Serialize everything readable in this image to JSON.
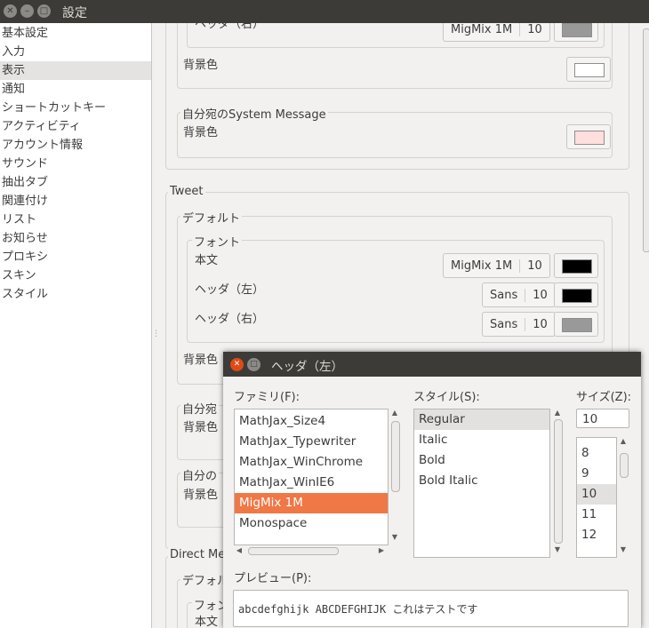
{
  "window": {
    "title": "設定"
  },
  "sidebar": {
    "items": [
      "基本設定",
      "入力",
      "表示",
      "通知",
      "ショートカットキー",
      "アクティビティ",
      "アカウント情報",
      "サウンド",
      "抽出タブ",
      "関連付け",
      "リスト",
      "お知らせ",
      "プロキシ",
      "スキン",
      "スタイル"
    ],
    "selected_index": 2
  },
  "content": {
    "top_group": {
      "header_label": "ヘッダ（右）",
      "font_name": "MigMix 1M",
      "font_size": "10",
      "bg_label": "背景色",
      "bg_color": "#ffffff",
      "header_color": "#999999"
    },
    "self_message": {
      "title": "自分宛のSystem Message",
      "bg_label": "背景色",
      "bg_color": "#ffdede"
    },
    "tweet": {
      "title": "Tweet",
      "default_title": "デフォルト",
      "font_title": "フォント",
      "rows": [
        {
          "label": "本文",
          "font": "MigMix 1M",
          "size": "10",
          "color": "#000000"
        },
        {
          "label": "ヘッダ（左）",
          "font": "Sans",
          "size": "10",
          "color": "#000000"
        },
        {
          "label": "ヘッダ（右）",
          "font": "Sans",
          "size": "10",
          "color": "#999999"
        }
      ],
      "bg_label": "背景色",
      "partial_1": "自分宛",
      "partial_1_bg": "背景色",
      "partial_2": "自分の",
      "partial_2_bg": "背景色"
    },
    "direct_message": {
      "title": "Direct Me",
      "default_title": "デフォル",
      "font_title": "フォン",
      "body_label": "本文"
    }
  },
  "dialog": {
    "title": "ヘッダ（左）",
    "family_label": "ファミリ(F):",
    "style_label": "スタイル(S):",
    "size_label": "サイズ(Z):",
    "families": [
      "MathJax_Size4",
      "MathJax_Typewriter",
      "MathJax_WinChrome",
      "MathJax_WinIE6",
      "MigMix 1M",
      "Monospace"
    ],
    "selected_family": "MigMix 1M",
    "styles": [
      "Regular",
      "Italic",
      "Bold",
      "Bold Italic"
    ],
    "selected_style": "Regular",
    "size_value": "10",
    "sizes": [
      "8",
      "9",
      "10",
      "11",
      "12"
    ],
    "selected_size": "10",
    "preview_label": "プレビュー(P):",
    "preview_text": "abcdefghijk ABCDEFGHIJK これはテストです"
  },
  "colors": {
    "titlebar": "#3c3b37",
    "accent": "#f07746",
    "close_button": "#df4a16"
  }
}
